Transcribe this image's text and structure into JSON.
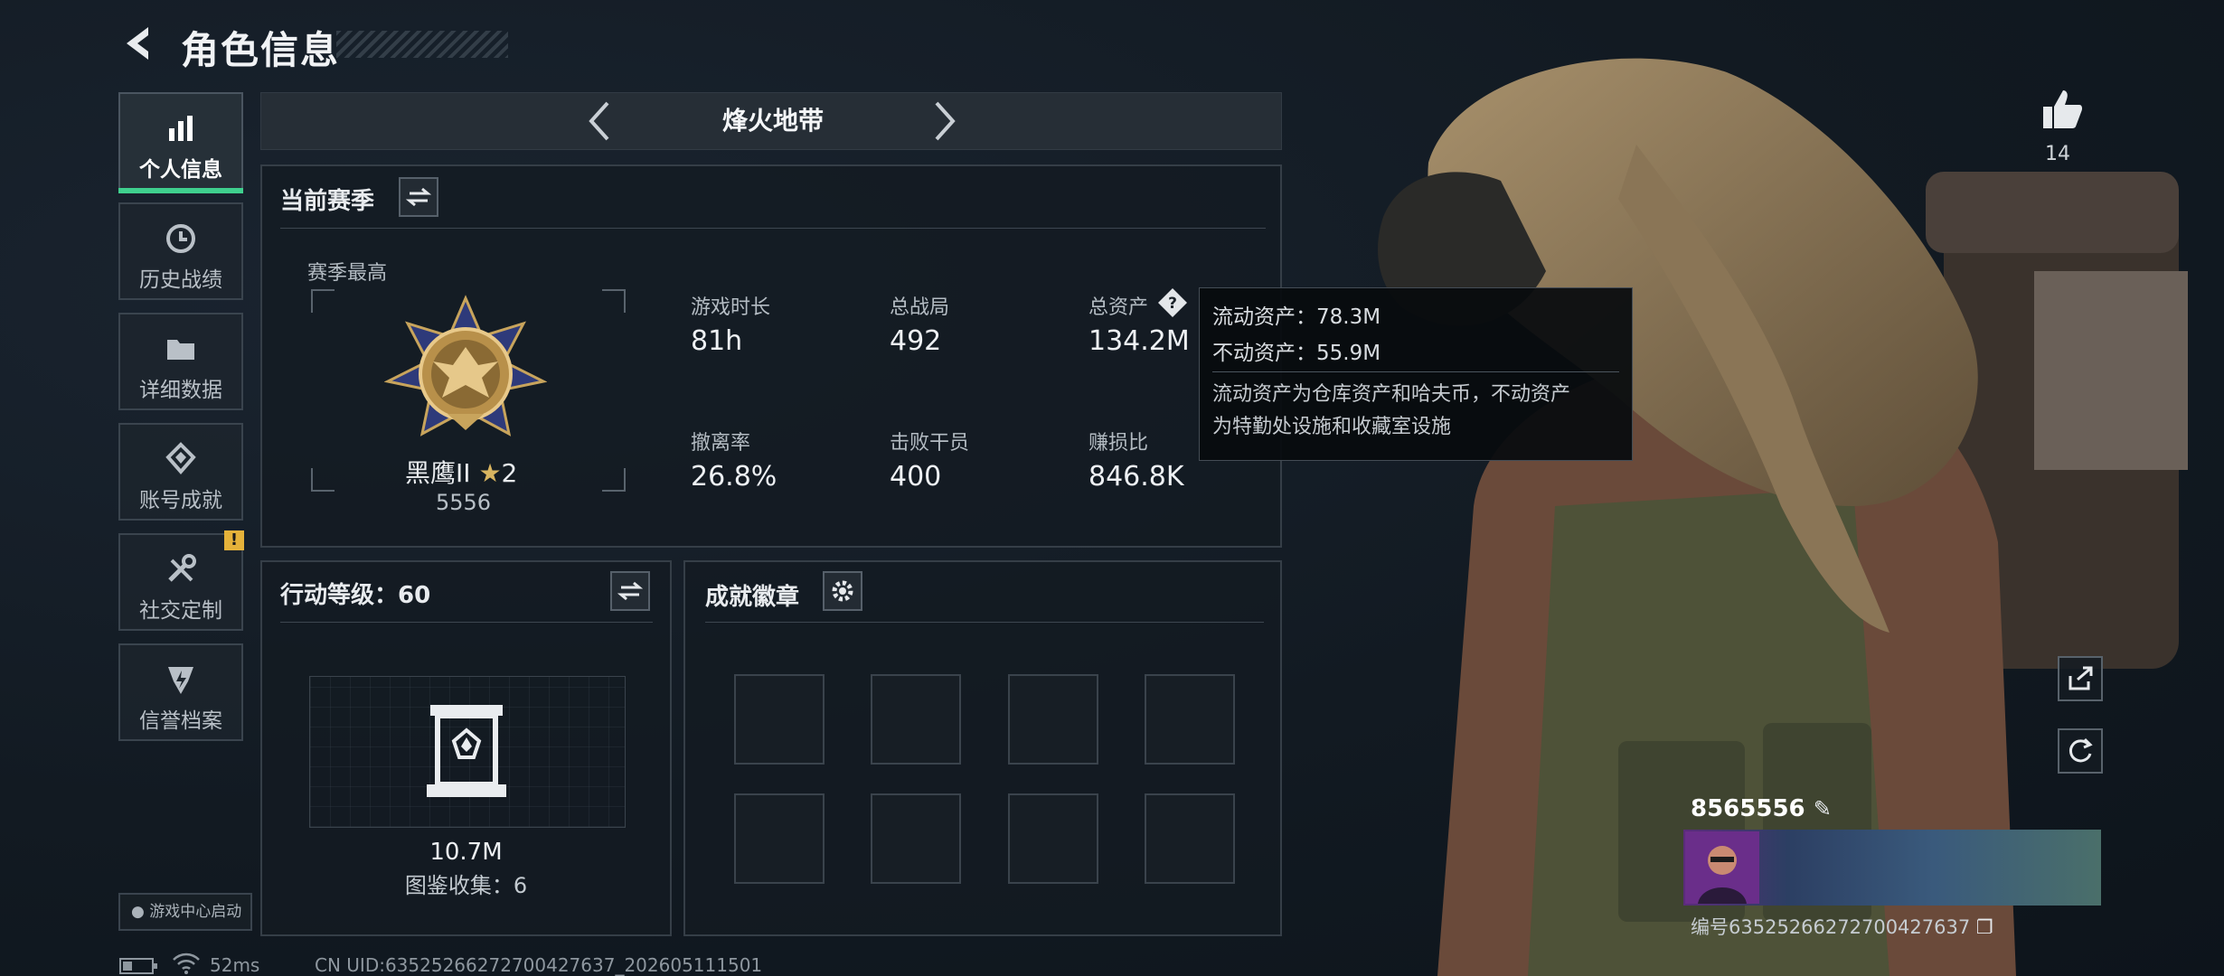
{
  "header": {
    "title": "角色信息"
  },
  "sidebar": {
    "items": [
      {
        "label": "个人信息",
        "active": true
      },
      {
        "label": "历史战绩"
      },
      {
        "label": "详细数据"
      },
      {
        "label": "账号成就"
      },
      {
        "label": "社交定制",
        "badge": "!"
      },
      {
        "label": "信誉档案"
      }
    ],
    "game_center_label": "游戏中心启动"
  },
  "mode_tab": {
    "title": "烽火地带"
  },
  "season": {
    "title": "当前赛季",
    "best_label": "赛季最高",
    "rank_name": "黑鹰II",
    "rank_stars": "2",
    "rank_score": "5556",
    "stats": [
      {
        "label": "游戏时长",
        "value": "81h"
      },
      {
        "label": "总战局",
        "value": "492"
      },
      {
        "label": "总资产",
        "value": "134.2M",
        "has_help": true
      },
      {
        "label": "撤离率",
        "value": "26.8%"
      },
      {
        "label": "击败干员",
        "value": "400"
      },
      {
        "label": "赚损比",
        "value": "846.8K"
      }
    ]
  },
  "tooltip": {
    "liquid": "流动资产：78.3M",
    "fixed": "不动资产：55.9M",
    "desc_line1": "流动资产为仓库资产和哈夫币，不动资产",
    "desc_line2": "为特勤处设施和收藏室设施"
  },
  "action_level": {
    "title": "行动等级：60",
    "collection_value": "10.7M",
    "collection_label": "图鉴收集：6"
  },
  "achievements": {
    "title": "成就徽章",
    "slot_count": 8
  },
  "profile": {
    "likes": "14",
    "player_name": "8565556",
    "uid_line": "编号6352526627270042763​7"
  },
  "footer": {
    "ping": "52ms",
    "uid": "CN UID:63525266272700427637_202605111501"
  },
  "colors": {
    "accent_green": "#3fd08e",
    "badge_yellow": "#e5b23a"
  }
}
